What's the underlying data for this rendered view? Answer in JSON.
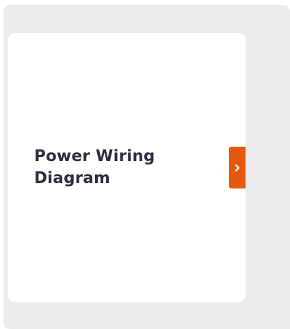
{
  "card": {
    "title": "Power Wiring Diagram"
  },
  "open_button": {
    "icon": "chevron-right-icon",
    "color": "#e5570d"
  },
  "colors": {
    "background_panel": "#ebebed",
    "card_background": "#ffffff",
    "title_text": "#2c2d3f"
  }
}
